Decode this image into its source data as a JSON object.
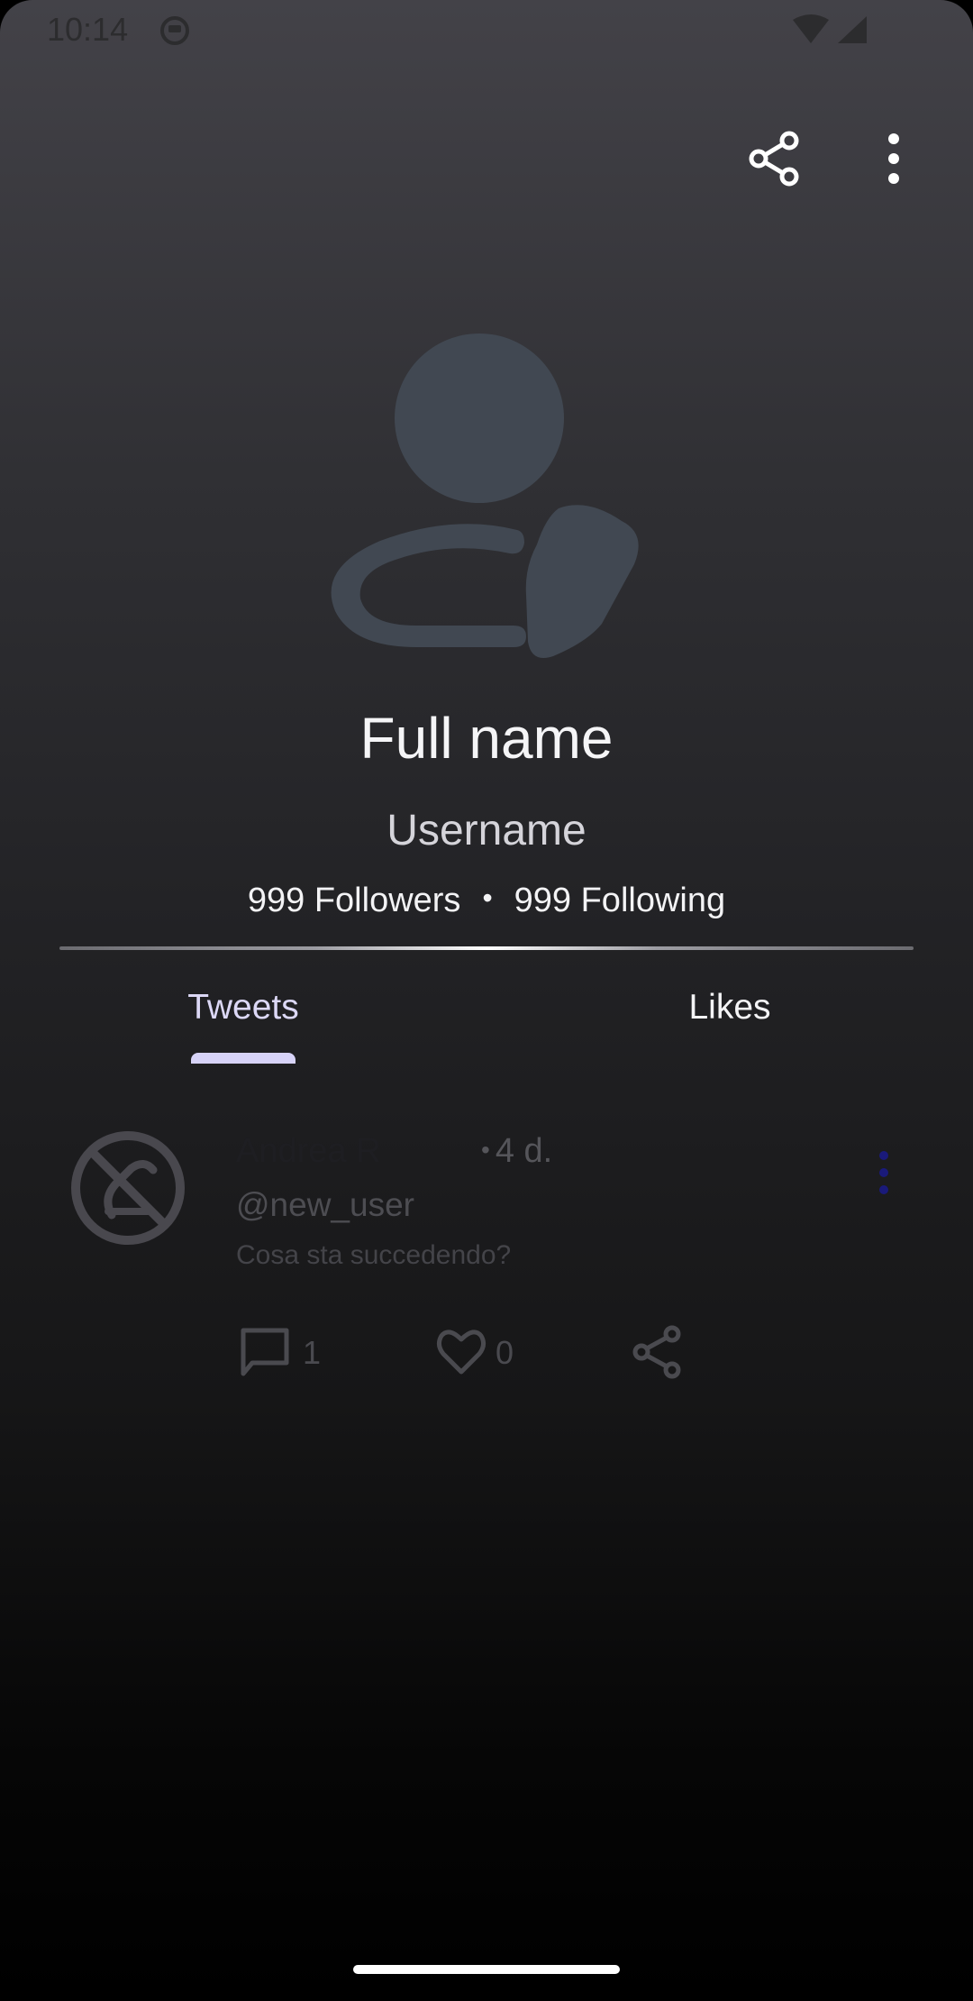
{
  "status_bar": {
    "time": "10:14",
    "icons": [
      "app-notification-icon",
      "wifi-icon",
      "signal-icon"
    ]
  },
  "top_bar": {
    "actions": [
      "share-icon",
      "more-vert-icon"
    ]
  },
  "profile": {
    "full_name": "Full name",
    "username": "Username",
    "followers": "999 Followers",
    "separator": "•",
    "following": "999 Following"
  },
  "tabs": [
    {
      "label": "Tweets",
      "selected": true
    },
    {
      "label": "Likes",
      "selected": false
    }
  ],
  "tweet": {
    "name": "Andrea R",
    "separator": "•",
    "time": "4 d.",
    "handle": "@new_user",
    "text": "Cosa sta succedendo?",
    "comments": "1",
    "likes": "0"
  },
  "colors": {
    "accent": "#d7d3f8",
    "background_top": "#434248",
    "background_bottom": "#000000",
    "more_icon_tweet": "#1a1a7a"
  }
}
